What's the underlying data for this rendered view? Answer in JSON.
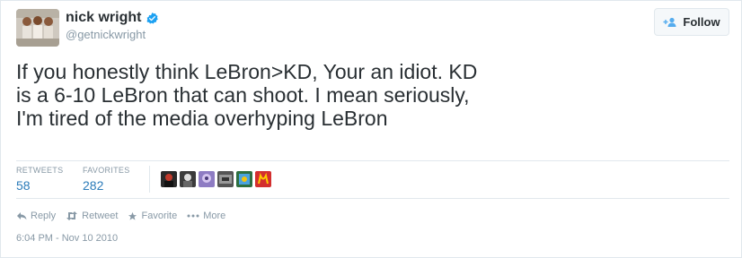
{
  "user": {
    "display_name": "nick wright",
    "handle": "@getnickwright",
    "verified_icon": "verified-badge-icon"
  },
  "follow_button": {
    "label": "Follow",
    "icon": "add-user-icon"
  },
  "tweet": {
    "text": "If you honestly think LeBron>KD, Your an idiot. KD\nis a 6-10 LeBron that can shoot. I mean seriously,\nI'm tired of the media overhyping LeBron"
  },
  "stats": {
    "retweets_label": "RETWEETS",
    "retweets_value": "58",
    "favorites_label": "FAVORITES",
    "favorites_value": "282"
  },
  "actions": {
    "reply": "Reply",
    "retweet": "Retweet",
    "favorite": "Favorite",
    "more": "More"
  },
  "timestamp": "6:04 PM - Nov 10 2010",
  "colors": {
    "link": "#2b7bb9",
    "muted": "#8899a6",
    "verified": "#1da1f2",
    "text": "#292f33"
  }
}
